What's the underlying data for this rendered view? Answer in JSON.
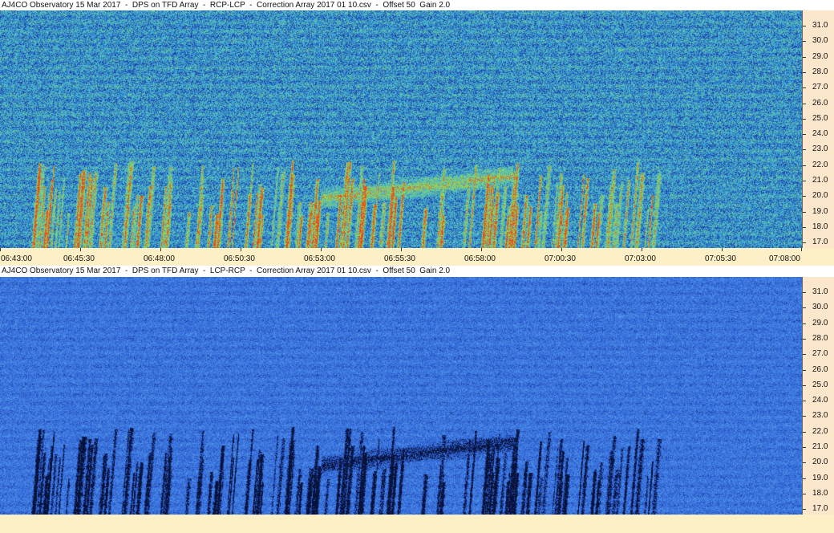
{
  "panels": [
    {
      "title": "AJ4CO Observatory 15 Mar 2017  -  DPS on TFD Array  -  RCP-LCP  -  Correction Array 2017 01 10.csv  -  Offset 50  Gain 2.0",
      "polarity": "positive",
      "colors": {
        "background": "#2a62c9",
        "low": "#1a3aa6",
        "mid": "#3fb0e0",
        "high": "#9be04a",
        "peak": "#e84a1a"
      }
    },
    {
      "title": "AJ4CO Observatory 15 Mar 2017  -  DPS on TFD Array  -  LCP-RCP  -  Correction Array 2017 01 10.csv  -  Offset 50  Gain 2.0",
      "polarity": "negative",
      "colors": {
        "background": "#2a62c9",
        "low": "#07123a",
        "mid": "#2a5ad0",
        "high": "#4c8ee8",
        "peak": "#6fb3f0"
      }
    }
  ],
  "frequency_labels": [
    "31.0",
    "30.0",
    "29.0",
    "28.0",
    "27.0",
    "26.0",
    "25.0",
    "24.0",
    "23.0",
    "22.0",
    "21.0",
    "20.0",
    "19.0",
    "18.0",
    "17.0"
  ],
  "time_labels": [
    "06:43:00",
    "06:45:30",
    "06:48:00",
    "06:50:30",
    "06:53:00",
    "06:55:30",
    "06:58:00",
    "07:00:30",
    "07:03:00",
    "07:05:30",
    "07:08:00"
  ],
  "axis_colors": {
    "frequency_axis_bg": "#fde7cc",
    "time_axis_bg": "#fdf0c6"
  }
}
